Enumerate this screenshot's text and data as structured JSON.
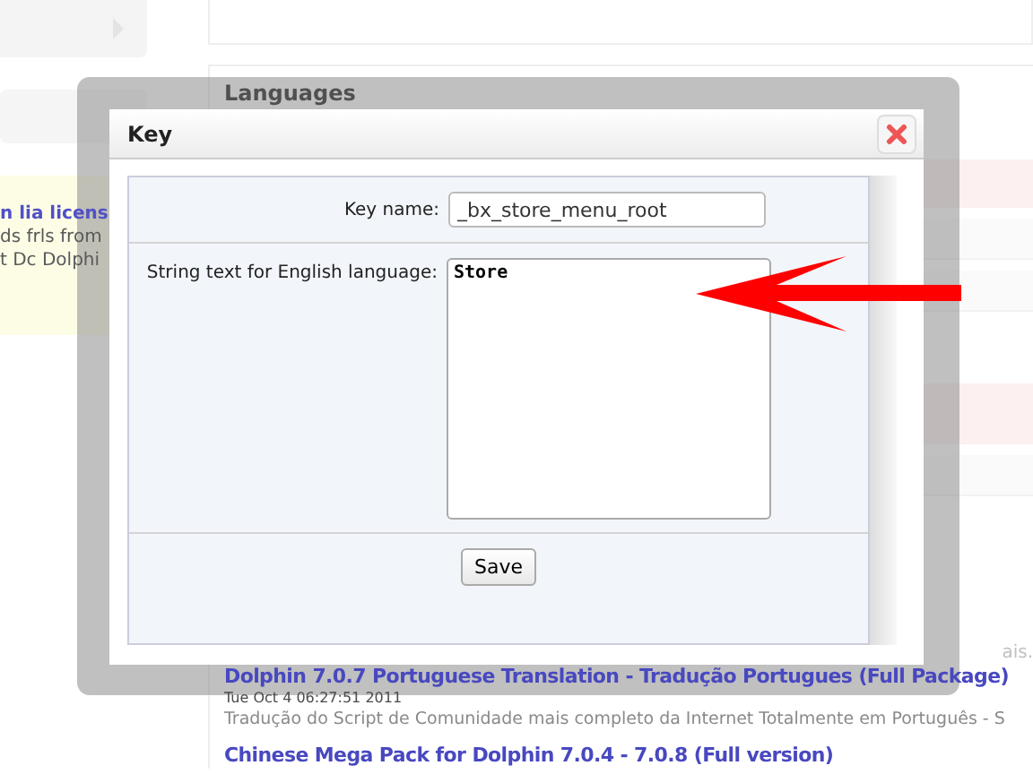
{
  "page": {
    "sidebar": {
      "notice_lines": [
        "n lia licens",
        "ds frls from",
        "t Dc Dolphi"
      ]
    },
    "main": {
      "section_title": "Languages",
      "trailing_text": "ais.",
      "items": [
        {
          "title": "Dolphin 7.0.7 Portuguese Translation - Tradução Portugues (Full Package)",
          "date": "Tue Oct 4 06:27:51 2011",
          "description": "Tradução do Script de Comunidade mais completo da Internet Totalmente em Português - S"
        },
        {
          "title": "Chinese Mega Pack for Dolphin 7.0.4 - 7.0.8 (Full version)"
        }
      ]
    }
  },
  "dialog": {
    "title": "Key",
    "fields": [
      {
        "kind": "input",
        "label": "Key name:",
        "value": "_bx_store_menu_root"
      },
      {
        "kind": "textarea",
        "label": "String text for English language:",
        "value": "Store"
      }
    ],
    "buttons": [
      "Save"
    ]
  }
}
